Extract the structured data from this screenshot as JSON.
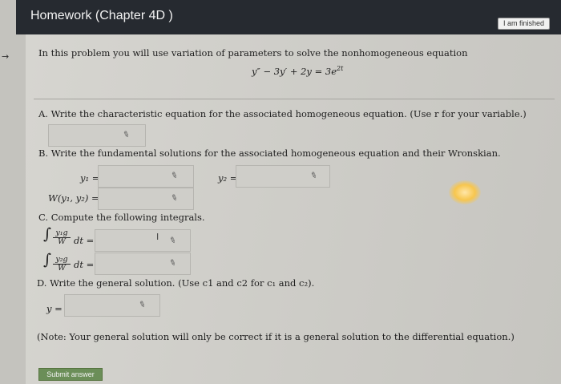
{
  "header": {
    "title": "Homework (Chapter 4D )",
    "finished_label": "I am finished"
  },
  "intro": {
    "text": "In this problem you will use variation of parameters to solve the nonhomogeneous equation",
    "equation": "y″ − 3y′ + 2y = 3e",
    "equation_exp": "2t"
  },
  "part_a": {
    "prompt": "A. Write the characteristic equation for the associated homogeneous equation. (Use r for your variable.)",
    "answer": ""
  },
  "part_b": {
    "prompt": "B. Write the fundamental solutions for the associated homogeneous equation and their Wronskian.",
    "y1_label": "y₁ =",
    "y2_label": "y₂ =",
    "wronskian_label": "W(y₁, y₂) =",
    "y1_answer": "",
    "y2_answer": "",
    "wronskian_answer": ""
  },
  "part_c": {
    "prompt": "C. Compute the following integrals.",
    "int1_num": "y₁g",
    "int1_den": "W",
    "int2_num": "y₂g",
    "int2_den": "W",
    "dt_label": "dt =",
    "int1_answer": "",
    "int2_answer": ""
  },
  "part_d": {
    "prompt": "D. Write the general solution. (Use c1 and c2 for c₁ and c₂).",
    "y_label": "y =",
    "answer": ""
  },
  "note": "(Note: Your general solution will only be correct if it is a general solution to the differential equation.)",
  "submit_label": "Submit answer",
  "icons": {
    "pencil": "✎",
    "arrow": "→",
    "cursor": "I"
  }
}
